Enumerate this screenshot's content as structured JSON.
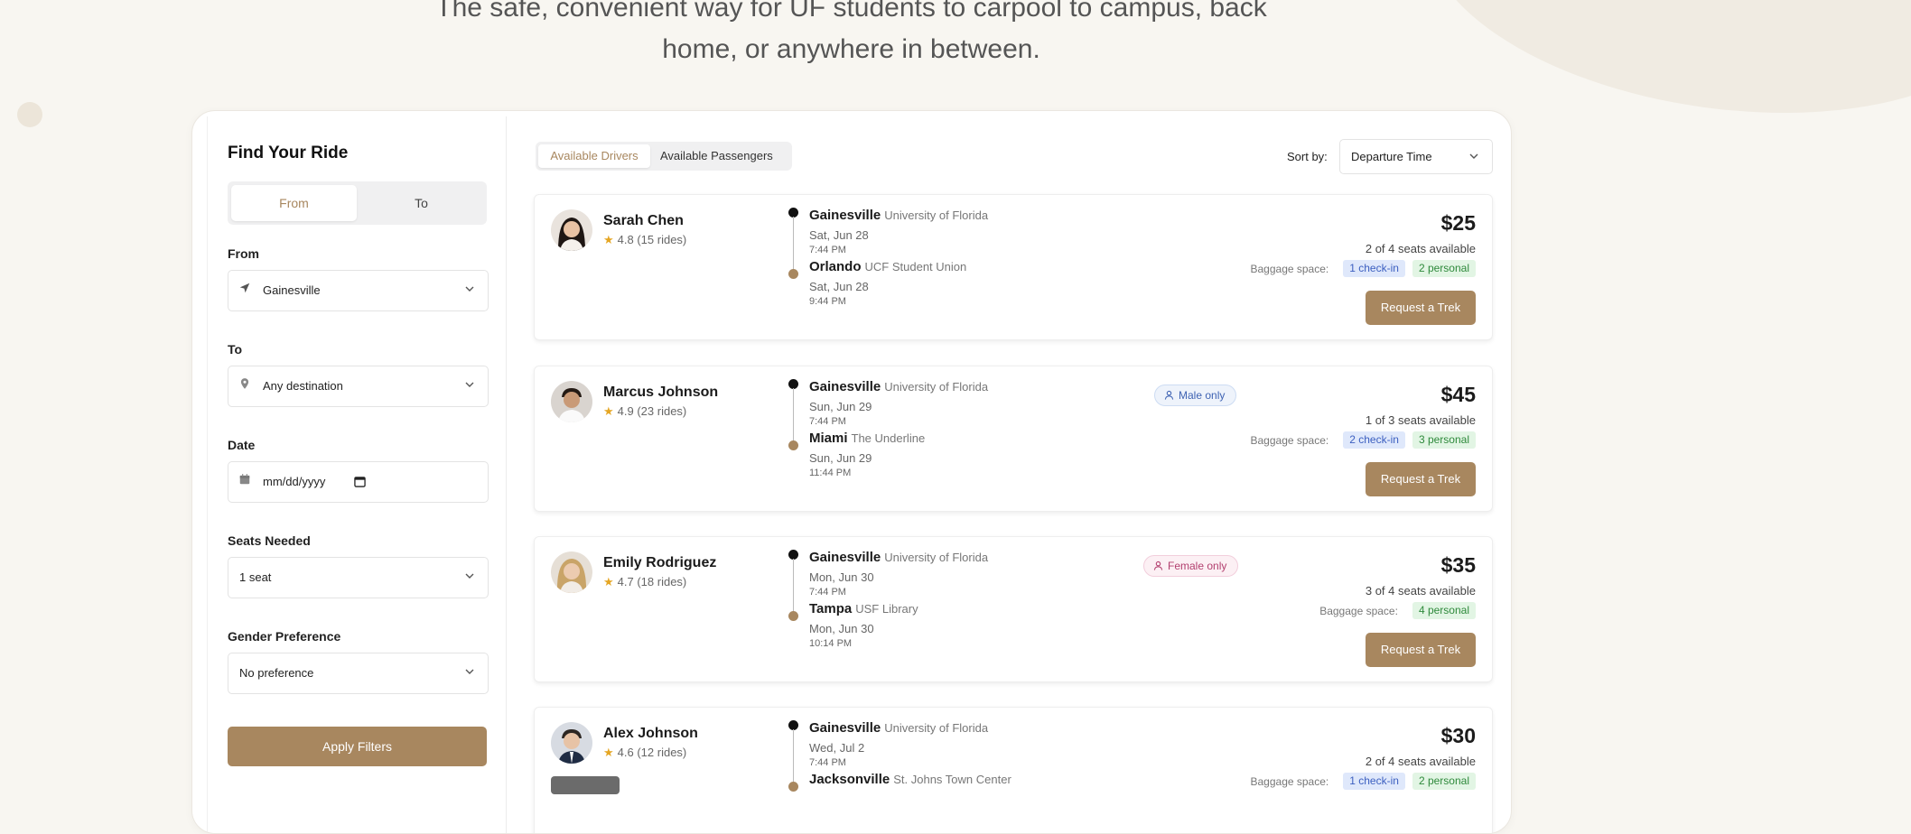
{
  "hero": {
    "line1": "The safe, convenient way for UF students to carpool to campus, back",
    "line2": "home, or anywhere in between."
  },
  "sidebar": {
    "title": "Find Your Ride",
    "toggle": {
      "from": "From",
      "to": "To"
    },
    "from_label": "From",
    "from_value": "Gainesville",
    "to_label": "To",
    "to_value": "Any destination",
    "date_label": "Date",
    "date_value": "mm/dd/yyyy",
    "seats_label": "Seats Needed",
    "seats_value": "1 seat",
    "gender_label": "Gender Preference",
    "gender_value": "No preference",
    "apply": "Apply Filters"
  },
  "tabs": {
    "drivers": "Available Drivers",
    "passengers": "Available Passengers"
  },
  "sort": {
    "label": "Sort by:",
    "value": "Departure Time"
  },
  "rides": [
    {
      "name": "Sarah Chen",
      "rating": "4.8 (15 rides)",
      "from_city": "Gainesville",
      "from_place": "University of Florida",
      "from_date": "Sat, Jun 28",
      "from_time": "7:44 PM",
      "to_city": "Orlando",
      "to_place": "UCF Student Union",
      "to_date": "Sat, Jun 28",
      "to_time": "9:44 PM",
      "pref": "",
      "price": "$25",
      "seats": "2 of 4 seats available",
      "baggage_label": "Baggage space:",
      "checkin": "1 check-in",
      "personal": "2 personal",
      "action": "Request a Trek"
    },
    {
      "name": "Marcus Johnson",
      "rating": "4.9 (23 rides)",
      "from_city": "Gainesville",
      "from_place": "University of Florida",
      "from_date": "Sun, Jun 29",
      "from_time": "7:44 PM",
      "to_city": "Miami",
      "to_place": "The Underline",
      "to_date": "Sun, Jun 29",
      "to_time": "11:44 PM",
      "pref": "Male only",
      "price": "$45",
      "seats": "1 of 3 seats available",
      "baggage_label": "Baggage space:",
      "checkin": "2 check-in",
      "personal": "3 personal",
      "action": "Request a Trek"
    },
    {
      "name": "Emily Rodriguez",
      "rating": "4.7 (18 rides)",
      "from_city": "Gainesville",
      "from_place": "University of Florida",
      "from_date": "Mon, Jun 30",
      "from_time": "7:44 PM",
      "to_city": "Tampa",
      "to_place": "USF Library",
      "to_date": "Mon, Jun 30",
      "to_time": "10:14 PM",
      "pref": "Female only",
      "price": "$35",
      "seats": "3 of 4 seats available",
      "baggage_label": "Baggage space:",
      "checkin": "",
      "personal": "4 personal",
      "action": "Request a Trek"
    },
    {
      "name": "Alex Johnson",
      "rating": "4.6 (12 rides)",
      "from_city": "Gainesville",
      "from_place": "University of Florida",
      "from_date": "Wed, Jul 2",
      "from_time": "7:44 PM",
      "to_city": "Jacksonville",
      "to_place": "St. Johns Town Center",
      "price": "$30",
      "seats": "2 of 4 seats available",
      "baggage_label": "Baggage space:",
      "checkin": "1 check-in",
      "personal": "2 personal"
    }
  ],
  "colors": {
    "accent": "#a8875f",
    "background": "#f8f6f1"
  }
}
